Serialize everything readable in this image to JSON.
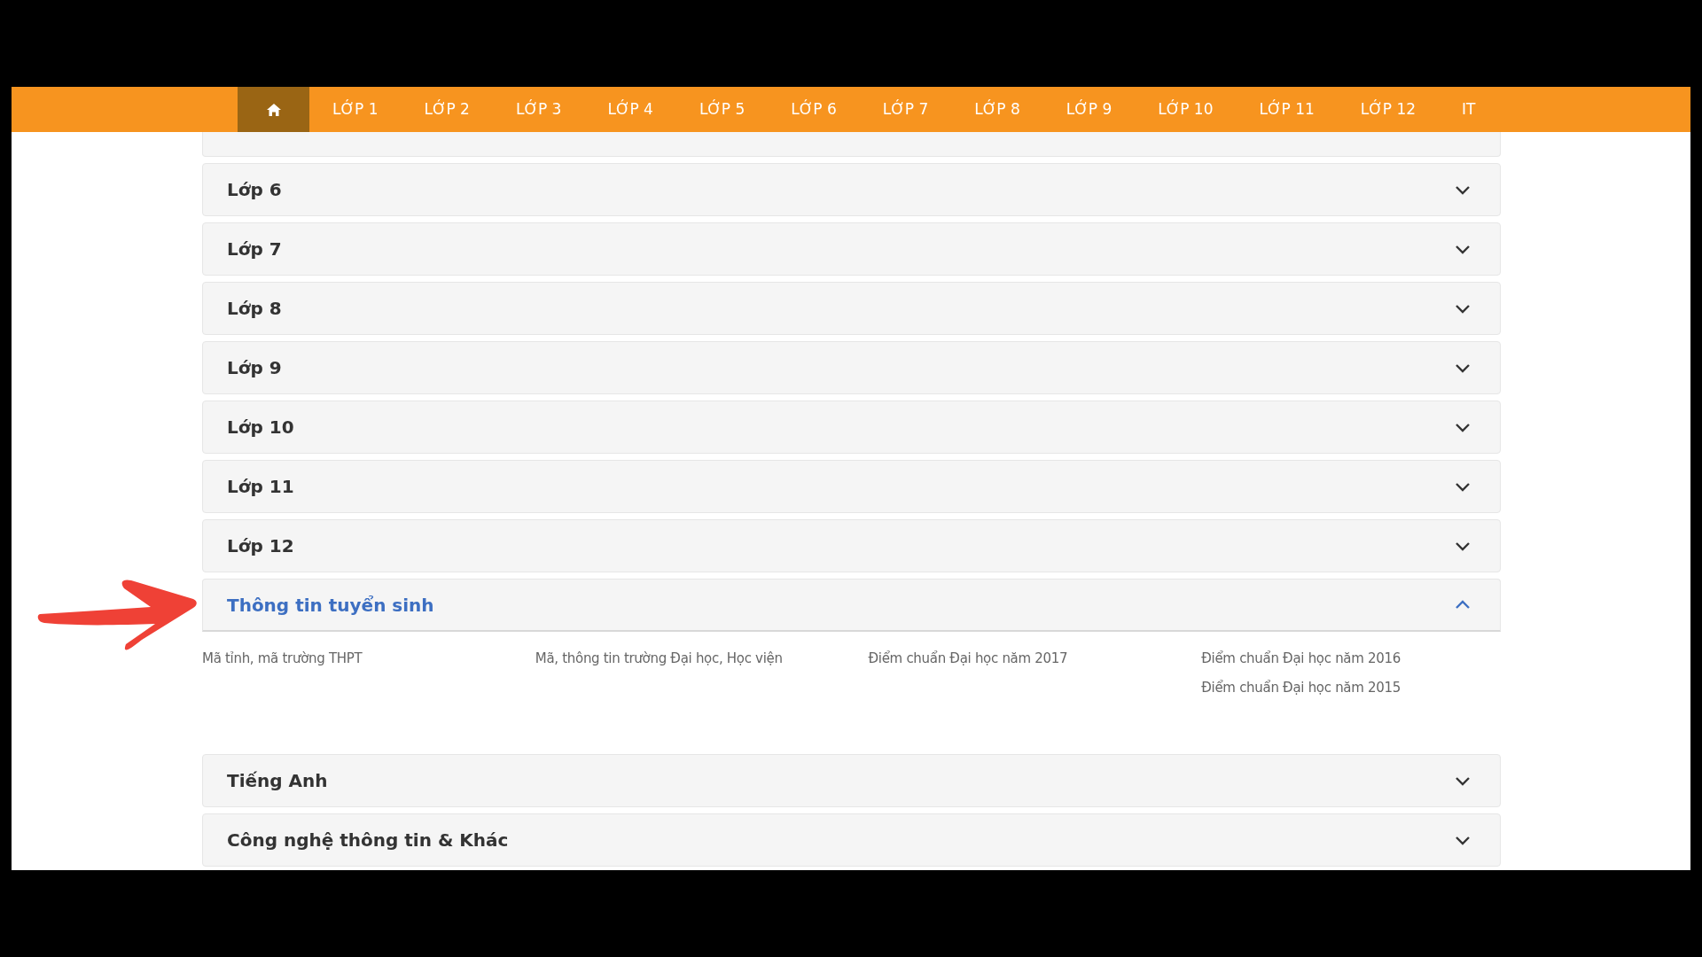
{
  "nav": {
    "items": [
      {
        "kind": "home",
        "selected": true
      },
      {
        "kind": "text",
        "label": "LỚP 1",
        "selected": false
      },
      {
        "kind": "text",
        "label": "LỚP 2",
        "selected": false
      },
      {
        "kind": "text",
        "label": "LỚP 3",
        "selected": false
      },
      {
        "kind": "text",
        "label": "LỚP 4",
        "selected": false
      },
      {
        "kind": "text",
        "label": "LỚP 5",
        "selected": false
      },
      {
        "kind": "text",
        "label": "LỚP 6",
        "selected": false
      },
      {
        "kind": "text",
        "label": "LỚP 7",
        "selected": false
      },
      {
        "kind": "text",
        "label": "LỚP 8",
        "selected": false
      },
      {
        "kind": "text",
        "label": "LỚP 9",
        "selected": false
      },
      {
        "kind": "text",
        "label": "LỚP 10",
        "selected": false
      },
      {
        "kind": "text",
        "label": "LỚP 11",
        "selected": false
      },
      {
        "kind": "text",
        "label": "LỚP 12",
        "selected": false
      },
      {
        "kind": "text",
        "label": "IT",
        "selected": false
      }
    ]
  },
  "accordion": [
    {
      "title": "Lớp 6",
      "expanded": false
    },
    {
      "title": "Lớp 7",
      "expanded": false
    },
    {
      "title": "Lớp 8",
      "expanded": false
    },
    {
      "title": "Lớp 9",
      "expanded": false
    },
    {
      "title": "Lớp 10",
      "expanded": false
    },
    {
      "title": "Lớp 11",
      "expanded": false
    },
    {
      "title": "Lớp 12",
      "expanded": false
    },
    {
      "title": "Thông tin tuyển sinh",
      "expanded": true,
      "columns": [
        [
          "Mã tỉnh, mã trường THPT"
        ],
        [
          "Mã, thông tin trường Đại học, Học viện"
        ],
        [
          "Điểm chuẩn Đại học năm 2017"
        ],
        [
          "Điểm chuẩn Đại học năm 2016",
          "Điểm chuẩn Đại học năm 2015"
        ]
      ]
    },
    {
      "title": "Tiếng Anh",
      "expanded": false
    },
    {
      "title": "Công nghệ thông tin & Khác",
      "expanded": false
    }
  ]
}
